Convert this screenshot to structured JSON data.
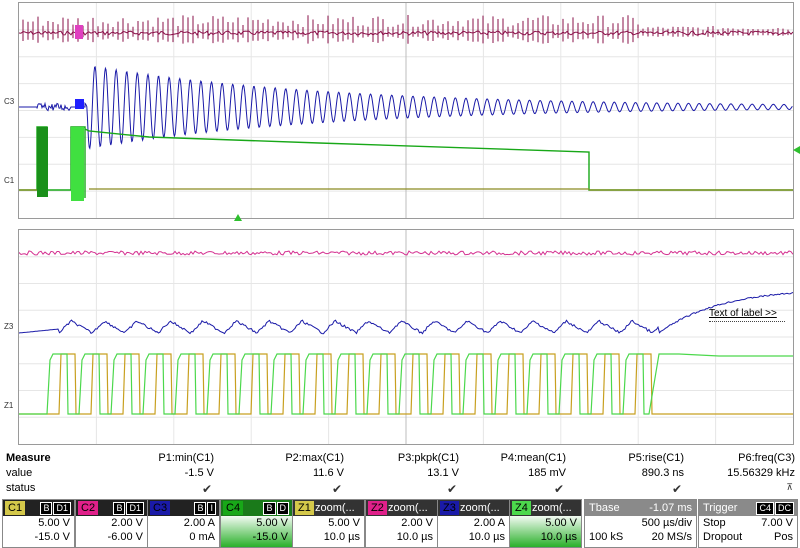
{
  "display": {
    "top_labels": [
      "C3",
      "C1"
    ],
    "bottom_labels": [
      "Z3",
      "Z1"
    ],
    "label_box_text": "Text of label >>"
  },
  "traces": {
    "colors": {
      "C1": "#d4c84a",
      "C2": "#e0208a",
      "C3": "#1a1aa8",
      "C4": "#18a818",
      "Z1": "#c8a020",
      "Z2": "#d43090",
      "Z3": "#1a1aa8",
      "Z4": "#4cd84c",
      "C2_top": "#8a1048"
    }
  },
  "measure": {
    "header": "Measure",
    "row_value_label": "value",
    "row_status_label": "status",
    "columns": [
      {
        "name": "P1:min(C1)",
        "value": "-1.5 V"
      },
      {
        "name": "P2:max(C1)",
        "value": "11.6 V"
      },
      {
        "name": "P3:pkpk(C1)",
        "value": "13.1 V"
      },
      {
        "name": "P4:mean(C1)",
        "value": "185 mV"
      },
      {
        "name": "P5:rise(C1)",
        "value": "890.3 ns"
      },
      {
        "name": "P6:freq(C3)",
        "value": "15.56329 kHz"
      }
    ],
    "status_checks": [
      "✔",
      "✔",
      "✔",
      "✔",
      "✔"
    ],
    "status_last": "⊼"
  },
  "descriptors": [
    {
      "id": "C1",
      "title": "",
      "badges": [
        "B",
        "D1"
      ],
      "line1": "5.00 V",
      "line2": "-15.0 V",
      "color": "#d4c84a"
    },
    {
      "id": "C2",
      "title": "",
      "badges": [
        "B",
        "D1"
      ],
      "line1": "2.00 V",
      "line2": "-6.00 V",
      "color": "#e0208a"
    },
    {
      "id": "C3",
      "title": "",
      "badges": [
        "B",
        "I"
      ],
      "line1": "2.00 A",
      "line2": "0 mA",
      "color": "#1a1aa8"
    },
    {
      "id": "C4",
      "title": "",
      "badges": [
        "B",
        "D"
      ],
      "line1": "5.00 V",
      "line2": "-15.0 V",
      "color": "#18a818"
    },
    {
      "id": "Z1",
      "title": "zoom(...",
      "badges": [],
      "line1": "5.00 V",
      "line2": "10.0 µs",
      "color": "#d4c84a"
    },
    {
      "id": "Z2",
      "title": "zoom(...",
      "badges": [],
      "line1": "2.00 V",
      "line2": "10.0 µs",
      "color": "#e0208a"
    },
    {
      "id": "Z3",
      "title": "zoom(...",
      "badges": [],
      "line1": "2.00 A",
      "line2": "10.0 µs",
      "color": "#1a1aa8"
    },
    {
      "id": "Z4",
      "title": "zoom(...",
      "badges": [],
      "line1": "5.00 V",
      "line2": "10.0 µs",
      "color": "#4cd84c"
    }
  ],
  "timebase": {
    "label": "Tbase",
    "offset": "-1.07 ms",
    "per_div": "500 µs/div",
    "samples": "100 kS",
    "rate": "20 MS/s"
  },
  "trigger": {
    "label": "Trigger",
    "badges": [
      "C4",
      "DC"
    ],
    "mode": "Stop",
    "level": "7.00 V",
    "type": "Dropout",
    "slope": "Pos"
  }
}
